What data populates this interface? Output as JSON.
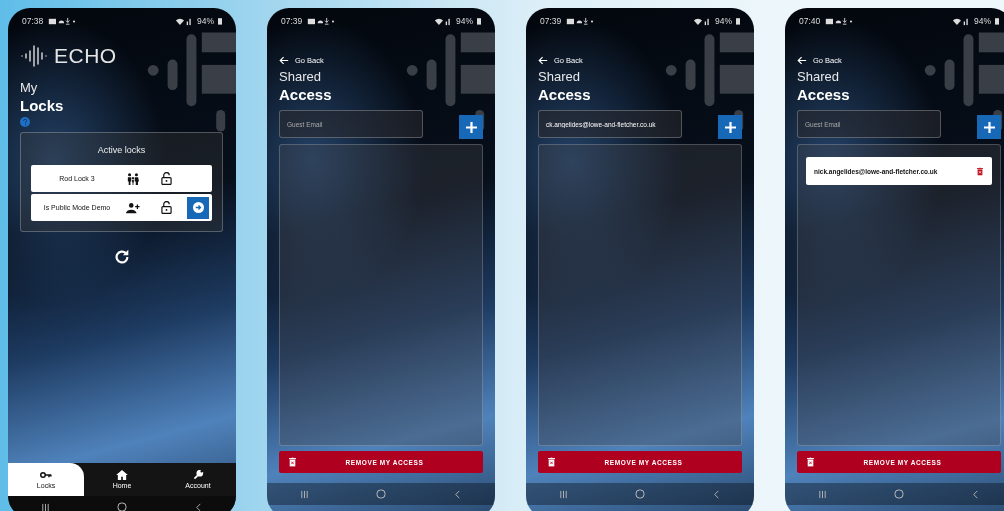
{
  "screens": [
    {
      "kind": "locks",
      "status_bar": {
        "time": "07:38",
        "battery": "94%"
      },
      "logo": {
        "text": "ECHO"
      },
      "heading": {
        "line1": "My",
        "line2": "Locks"
      },
      "panel_title": "Active locks",
      "locks": [
        {
          "name": "Rod Lock 3",
          "kind": "family",
          "action": false
        },
        {
          "name": "Is Public Mode Demo",
          "kind": "add-person",
          "action": true
        }
      ],
      "tabs": [
        {
          "label": "Locks",
          "kind": "key",
          "selected": true
        },
        {
          "label": "Home",
          "kind": "house",
          "selected": false
        },
        {
          "label": "Account",
          "kind": "wrench",
          "selected": false
        }
      ]
    },
    {
      "kind": "shared",
      "status_bar": {
        "time": "07:39",
        "battery": "94%"
      },
      "back": "Go Back",
      "heading": {
        "line1": "Shared",
        "line2": "Access"
      },
      "email_field": {
        "placeholder": "Guest Email"
      },
      "remove_button": "REMOVE MY ACCESS"
    },
    {
      "kind": "shared",
      "status_bar": {
        "time": "07:39",
        "battery": "94%"
      },
      "back": "Go Back",
      "heading": {
        "line1": "Shared",
        "line2": "Access"
      },
      "email_field": {
        "value": "ck.angelides@lowe-and-fletcher.co.uk"
      },
      "remove_button": "REMOVE MY ACCESS"
    },
    {
      "kind": "shared",
      "status_bar": {
        "time": "07:40",
        "battery": "94%"
      },
      "back": "Go Back",
      "heading": {
        "line1": "Shared",
        "line2": "Access"
      },
      "email_field": {
        "placeholder": "Guest Email"
      },
      "guests": [
        {
          "email": "nick.angelides@lowe-and-fletcher.co.uk"
        }
      ],
      "remove_button": "REMOVE MY ACCESS"
    }
  ]
}
